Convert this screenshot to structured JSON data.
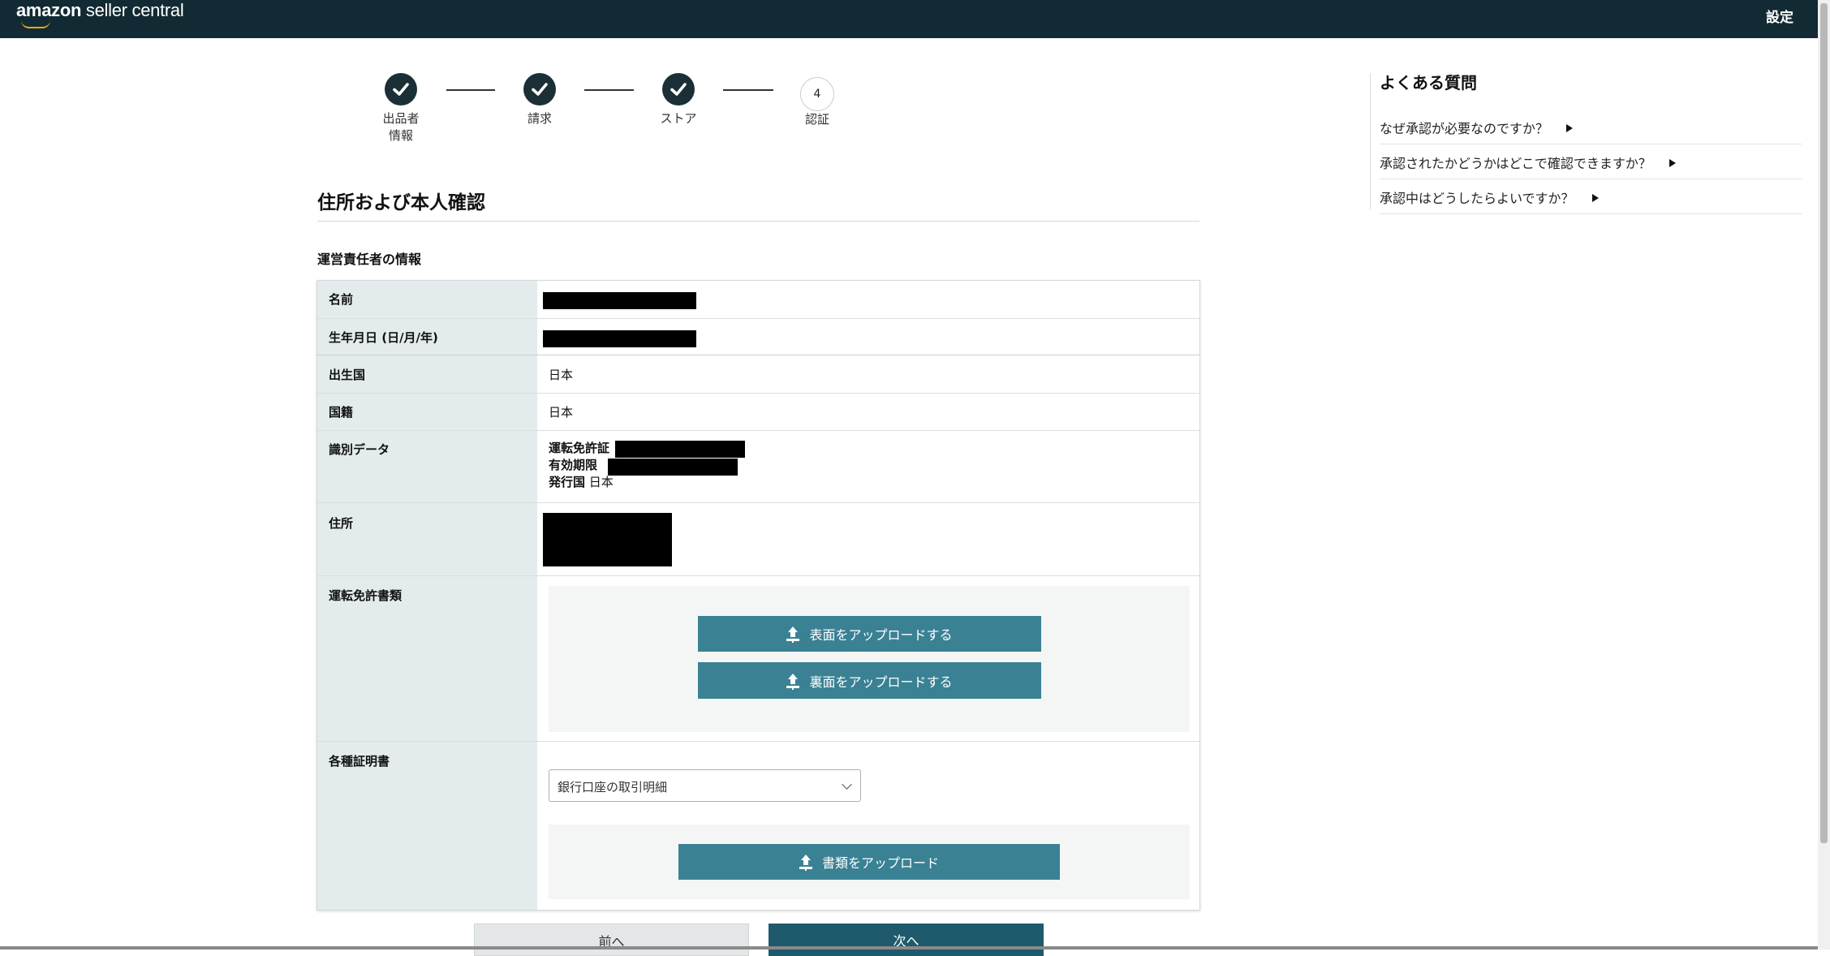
{
  "header": {
    "logo_primary": "amazon",
    "logo_secondary": " seller central",
    "settings_label": "設定"
  },
  "stepper": {
    "steps": [
      {
        "label": "出品者\n情報",
        "status": "complete"
      },
      {
        "label": "請求",
        "status": "complete"
      },
      {
        "label": "ストア",
        "status": "complete"
      },
      {
        "label": "認証",
        "number": "4",
        "status": "current"
      }
    ]
  },
  "main": {
    "page_title": "住所および本人確認",
    "section_title": "運営責任者の情報",
    "rows": {
      "name_label": "名前",
      "dob_label": "生年月日 (日/月/年)",
      "birth_country_label": "出生国",
      "birth_country_value": "日本",
      "nationality_label": "国籍",
      "nationality_value": "日本",
      "id_data_label": "識別データ",
      "id_license_label": "運転免許証",
      "id_expiry_label": "有効期限",
      "id_issuer_label": "発行国",
      "id_issuer_value": "日本",
      "address_label": "住所",
      "license_docs_label": "運転免許書類",
      "upload_front_label": "表面をアップロードする",
      "upload_back_label": "裏面をアップロードする",
      "certificates_label": "各種証明書",
      "certificate_type_selected": "銀行口座の取引明細",
      "upload_document_label": "書類をアップロード"
    },
    "prev_label": "前へ",
    "next_label": "次へ"
  },
  "faq": {
    "title": "よくある質問",
    "items": [
      "なぜ承認が必要なのですか？",
      "承認されたかどうかはどこで確認できますか？",
      "承認中はどうしたらよいですか？"
    ]
  },
  "colors": {
    "topbar": "#122a33",
    "button_primary": "#3a8194",
    "button_next": "#1e5a6b",
    "label_column": "#e3ebec"
  }
}
